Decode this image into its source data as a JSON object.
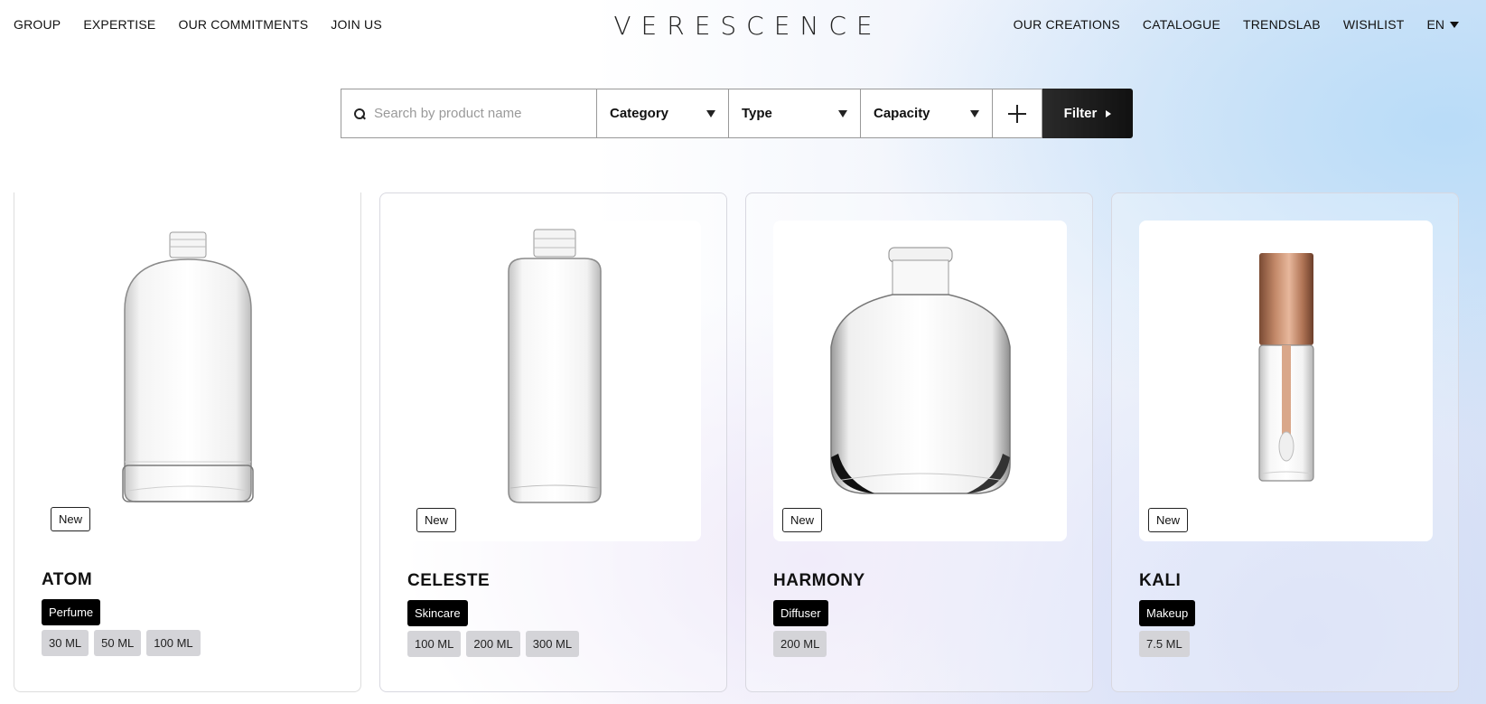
{
  "header": {
    "logo": "VERESCENCE",
    "nav_left": [
      "GROUP",
      "EXPERTISE",
      "OUR COMMITMENTS",
      "JOIN US"
    ],
    "nav_right": [
      "OUR CREATIONS",
      "CATALOGUE",
      "TRENDSLAB",
      "WISHLIST"
    ],
    "language": "EN"
  },
  "search": {
    "placeholder": "Search by product name",
    "category_label": "Category",
    "type_label": "Type",
    "capacity_label": "Capacity",
    "filter_label": "Filter"
  },
  "products": [
    {
      "badge": "New",
      "name": "ATOM",
      "category": "Perfume",
      "capacities": [
        "30 ML",
        "50 ML",
        "100 ML"
      ]
    },
    {
      "badge": "New",
      "name": "CELESTE",
      "category": "Skincare",
      "capacities": [
        "100 ML",
        "200 ML",
        "300 ML"
      ]
    },
    {
      "badge": "New",
      "name": "HARMONY",
      "category": "Diffuser",
      "capacities": [
        "200 ML"
      ]
    },
    {
      "badge": "New",
      "name": "KALI",
      "category": "Makeup",
      "capacities": [
        "7.5 ML"
      ]
    }
  ],
  "icons": {
    "search": "search-icon",
    "dropdown": "triangle-down-icon",
    "add": "plus-icon",
    "filter_arrow": "triangle-right-icon"
  },
  "colors": {
    "accent_dark": "#111111",
    "tag_background": "#d4d4d8",
    "cap_bronze": "#a8684a"
  }
}
